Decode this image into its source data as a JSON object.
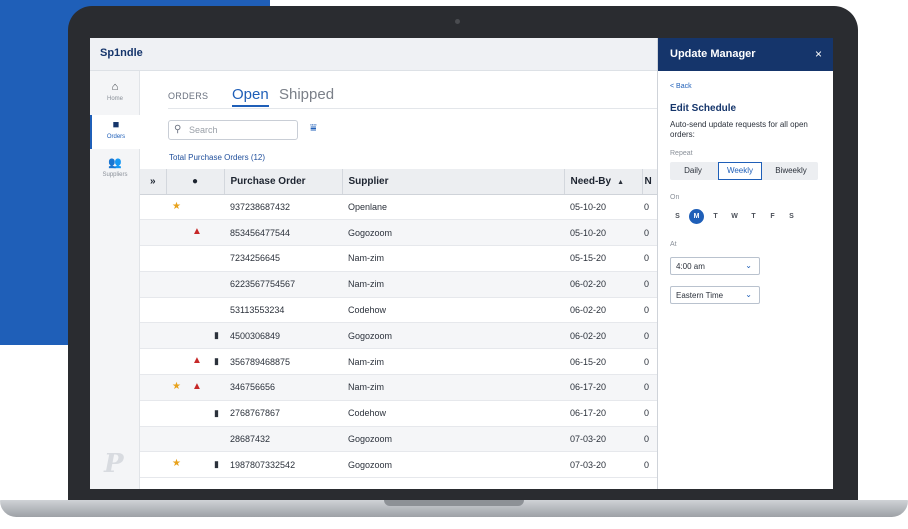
{
  "app": {
    "logo": "Sp1ndle"
  },
  "nav": {
    "items": [
      {
        "label": "Home",
        "icon": "home-icon",
        "glyph": "⌂"
      },
      {
        "label": "Orders",
        "icon": "folder-icon",
        "glyph": "■"
      },
      {
        "label": "Suppliers",
        "icon": "users-icon",
        "glyph": "👥"
      }
    ]
  },
  "main": {
    "section_label": "ORDERS",
    "tabs": [
      {
        "label": "Open"
      },
      {
        "label": "Shipped"
      }
    ],
    "search": {
      "placeholder": "Search",
      "icon": "search-icon"
    },
    "total": "Total Purchase Orders (12)",
    "columns": {
      "info_icon": "info-icon",
      "purchase_order": "Purchase Order",
      "supplier": "Supplier",
      "need_by": "Need-By",
      "next": "N"
    },
    "rows": [
      {
        "star": true,
        "alert": false,
        "clip": false,
        "po": "937238687432",
        "supplier": "Openlane",
        "need_by": "05-10-20",
        "next": "0"
      },
      {
        "star": false,
        "alert": true,
        "clip": false,
        "po": "853456477544",
        "supplier": "Gogozoom",
        "need_by": "05-10-20",
        "next": "0"
      },
      {
        "star": false,
        "alert": false,
        "clip": false,
        "po": "7234256645",
        "supplier": "Nam-zim",
        "need_by": "05-15-20",
        "next": "0"
      },
      {
        "star": false,
        "alert": false,
        "clip": false,
        "po": "6223567754567",
        "supplier": "Nam-zim",
        "need_by": "06-02-20",
        "next": "0"
      },
      {
        "star": false,
        "alert": false,
        "clip": false,
        "po": "53113553234",
        "supplier": "Codehow",
        "need_by": "06-02-20",
        "next": "0"
      },
      {
        "star": false,
        "alert": false,
        "clip": true,
        "po": "4500306849",
        "supplier": "Gogozoom",
        "need_by": "06-02-20",
        "next": "0"
      },
      {
        "star": false,
        "alert": true,
        "clip": true,
        "po": "356789468875",
        "supplier": "Nam-zim",
        "need_by": "06-15-20",
        "next": "0"
      },
      {
        "star": true,
        "alert": true,
        "clip": false,
        "po": "346756656",
        "supplier": "Nam-zim",
        "need_by": "06-17-20",
        "next": "0"
      },
      {
        "star": false,
        "alert": false,
        "clip": true,
        "po": "2768767867",
        "supplier": "Codehow",
        "need_by": "06-17-20",
        "next": "0"
      },
      {
        "star": false,
        "alert": false,
        "clip": false,
        "po": "28687432",
        "supplier": "Gogozoom",
        "need_by": "07-03-20",
        "next": "0"
      },
      {
        "star": true,
        "alert": false,
        "clip": true,
        "po": "1987807332542",
        "supplier": "Gogozoom",
        "need_by": "07-03-20",
        "next": "0"
      }
    ]
  },
  "panel": {
    "title": "Update Manager",
    "close": "×",
    "back": "< Back",
    "heading": "Edit Schedule",
    "description": "Auto-send update requests for all open orders:",
    "repeat_label": "Repeat",
    "repeat_options": [
      "Daily",
      "Weekly",
      "Biweekly"
    ],
    "repeat_selected": "Weekly",
    "on_label": "On",
    "days": [
      "S",
      "M",
      "T",
      "W",
      "T",
      "F",
      "S"
    ],
    "day_selected": "M",
    "at_label": "At",
    "time": "4:00 am",
    "timezone": "Eastern Time"
  },
  "colors": {
    "brand_blue": "#1f5fb8",
    "navy": "#15356b",
    "alert_red": "#c62828",
    "star_gold": "#e8a21c"
  }
}
